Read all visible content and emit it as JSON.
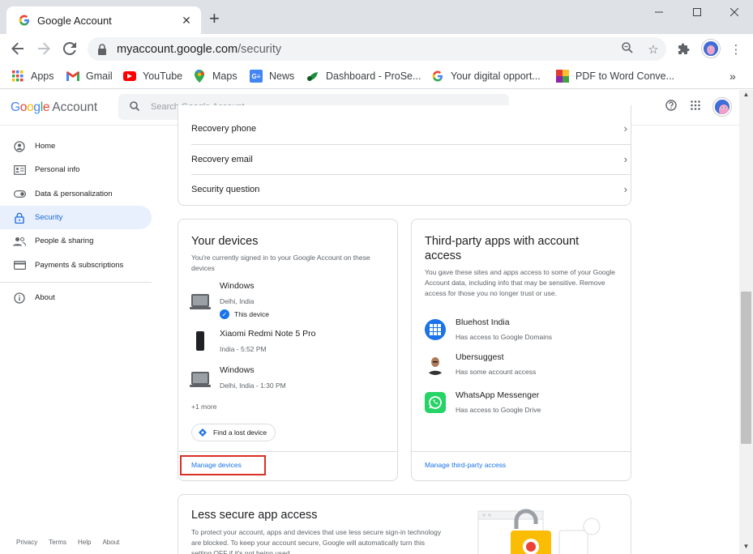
{
  "browser": {
    "tab_title": "Google Account",
    "url_host": "myaccount.google.com",
    "url_path": "/security"
  },
  "bookmarks": [
    {
      "label": "Apps"
    },
    {
      "label": "Gmail"
    },
    {
      "label": "YouTube"
    },
    {
      "label": "Maps"
    },
    {
      "label": "News"
    },
    {
      "label": "Dashboard - ProSe..."
    },
    {
      "label": "Your digital opport..."
    },
    {
      "label": "PDF to Word Conve..."
    }
  ],
  "header": {
    "logo_google": "Google",
    "logo_account": "Account",
    "search_placeholder": "Search Google Account"
  },
  "sidebar": {
    "items": [
      {
        "label": "Home",
        "icon": "person-circle-icon"
      },
      {
        "label": "Personal info",
        "icon": "id-card-icon"
      },
      {
        "label": "Data & personalization",
        "icon": "toggle-icon"
      },
      {
        "label": "Security",
        "icon": "lock-icon",
        "active": true
      },
      {
        "label": "People & sharing",
        "icon": "people-icon"
      },
      {
        "label": "Payments & subscriptions",
        "icon": "credit-card-icon"
      },
      {
        "label": "About",
        "icon": "info-icon"
      }
    ],
    "footer": [
      "Privacy",
      "Terms",
      "Help",
      "About"
    ]
  },
  "recovery": {
    "rows": [
      "Recovery phone",
      "Recovery email",
      "Security question"
    ]
  },
  "devices_card": {
    "title": "Your devices",
    "desc": "You're currently signed in to your Google Account on these devices",
    "devices": [
      {
        "name": "Windows",
        "location": "Delhi, India",
        "badge": "This device"
      },
      {
        "name": "Xiaomi Redmi Note 5 Pro",
        "location": "India - 5:52 PM"
      },
      {
        "name": "Windows",
        "location": "Delhi, India - 1:30 PM"
      }
    ],
    "more": "+1 more",
    "find_button": "Find a lost device",
    "manage_link": "Manage devices"
  },
  "apps_card": {
    "title": "Third-party apps with account access",
    "desc": "You gave these sites and apps access to some of your Google Account data, including info that may be sensitive. Remove access for those you no longer trust or use.",
    "apps": [
      {
        "name": "Bluehost India",
        "access": "Has access to Google Domains",
        "icon": "bluehost-icon"
      },
      {
        "name": "Ubersuggest",
        "access": "Has some account access",
        "icon": "ubersuggest-avatar-icon"
      },
      {
        "name": "WhatsApp Messenger",
        "access": "Has access to Google Drive",
        "icon": "whatsapp-icon"
      }
    ],
    "manage_link": "Manage third-party access"
  },
  "less_secure": {
    "title": "Less secure app access",
    "desc": "To protect your account, apps and devices that use less secure sign-in technology are blocked. To keep your account secure, Google will automatically turn this setting OFF if it's not being used."
  },
  "colors": {
    "accent": "#1a73e8",
    "active_bg": "#e8f0fe",
    "highlight_box": "#d93025"
  }
}
